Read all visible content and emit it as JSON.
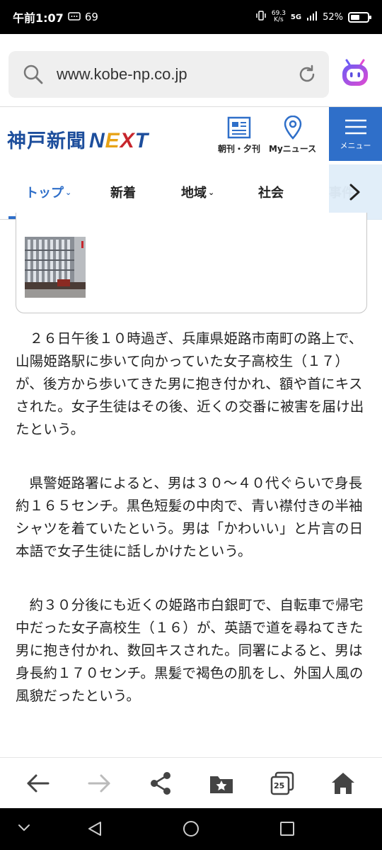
{
  "status_bar": {
    "time": "午前1:07",
    "notification_count": "69",
    "net_speed_value": "69.3",
    "net_speed_unit": "K/s",
    "network": "5G",
    "battery": "52%"
  },
  "browser": {
    "url": "www.kobe-np.co.jp",
    "icons": [
      "search-icon",
      "reload-icon",
      "assistant-bot-icon"
    ]
  },
  "site_header": {
    "logo_text": "神戸新聞",
    "logo_next": [
      "N",
      "E",
      "X",
      "T"
    ],
    "newspaper_label": "朝刊・夕刊",
    "my_news_label": "Myニュース",
    "menu_label": "メニュー"
  },
  "nav_tabs": [
    {
      "label": "トップ",
      "has_caret": true,
      "active": true
    },
    {
      "label": "新着",
      "has_caret": false
    },
    {
      "label": "地域",
      "has_caret": true
    },
    {
      "label": "社会",
      "has_caret": false
    },
    {
      "label": "事件",
      "has_caret": false
    }
  ],
  "article": {
    "paragraphs": [
      "２６日午後１０時過ぎ、兵庫県姫路市南町の路上で、山陽姫路駅に歩いて向かっていた女子高校生（１７）が、後方から歩いてきた男に抱き付かれ、額や首にキスされた。女子生徒はその後、近くの交番に被害を届け出たという。",
      "県警姫路署によると、男は３０～４０代ぐらいで身長約１６５センチ。黒色短髪の中肉で、青い襟付きの半袖シャツを着ていたという。男は「かわいい」と片言の日本語で女子生徒に話しかけたという。",
      "約３０分後にも近くの姫路市白銀町で、自転車で帰宅中だった女子高校生（１６）が、英語で道を尋ねてきた男に抱き付かれ、数回キスされた。同署によると、男は身長約１７０センチ。黒髪で褐色の肌をし、外国人風の風貌だったという。"
    ]
  },
  "bottom_toolbar": {
    "tab_count": "25",
    "icons": [
      "back-arrow-icon",
      "forward-arrow-icon",
      "share-icon",
      "bookmarks-icon",
      "tabs-icon",
      "home-icon"
    ]
  },
  "colors": {
    "brand_blue": "#2f6fc9",
    "logo_blue": "#1d4e9c",
    "next_orange": "#e7a317",
    "next_red": "#c7262d"
  }
}
